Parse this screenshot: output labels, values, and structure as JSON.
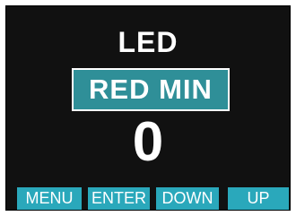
{
  "screen": {
    "title": "LED",
    "parameter": "RED MIN",
    "value": "0"
  },
  "softkeys": [
    {
      "label": "MENU"
    },
    {
      "label": "ENTER"
    },
    {
      "label": "DOWN"
    },
    {
      "label": "UP"
    }
  ],
  "colors": {
    "background": "#111111",
    "highlight": "#2f8f98",
    "softkey": "#2aa8bb",
    "text": "#ffffff"
  }
}
